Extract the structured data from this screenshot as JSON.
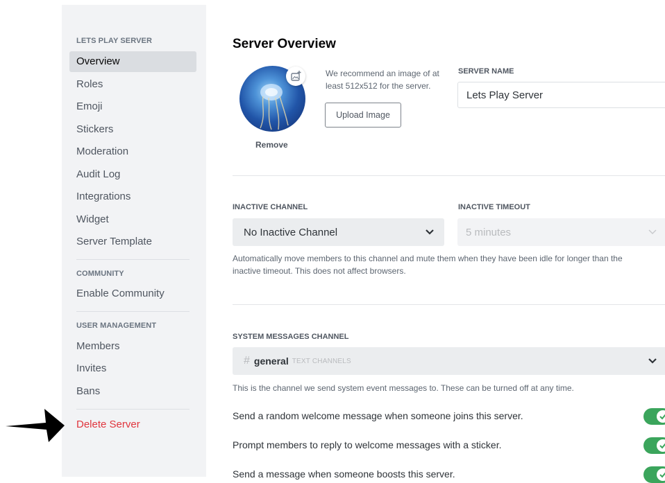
{
  "sidebar": {
    "server_header": "LETS PLAY SERVER",
    "items": [
      {
        "label": "Overview"
      },
      {
        "label": "Roles"
      },
      {
        "label": "Emoji"
      },
      {
        "label": "Stickers"
      },
      {
        "label": "Moderation"
      },
      {
        "label": "Audit Log"
      },
      {
        "label": "Integrations"
      },
      {
        "label": "Widget"
      },
      {
        "label": "Server Template"
      }
    ],
    "community_header": "COMMUNITY",
    "community_items": [
      {
        "label": "Enable Community"
      }
    ],
    "user_mgmt_header": "USER MANAGEMENT",
    "user_mgmt_items": [
      {
        "label": "Members"
      },
      {
        "label": "Invites"
      },
      {
        "label": "Bans"
      }
    ],
    "delete_label": "Delete Server"
  },
  "overview": {
    "title": "Server Overview",
    "remove_label": "Remove",
    "recommend_text": "We recommend an image of at least 512x512 for the server.",
    "upload_label": "Upload Image",
    "server_name_label": "SERVER NAME",
    "server_name_value": "Lets Play Server",
    "inactive_channel_label": "INACTIVE CHANNEL",
    "inactive_channel_value": "No Inactive Channel",
    "inactive_timeout_label": "INACTIVE TIMEOUT",
    "inactive_timeout_value": "5 minutes",
    "inactive_help": "Automatically move members to this channel and mute them when they have been idle for longer than the inactive timeout. This does not affect browsers.",
    "system_channel_label": "SYSTEM MESSAGES CHANNEL",
    "system_channel_hash": "#",
    "system_channel_name": "general",
    "system_channel_category": "TEXT CHANNELS",
    "system_help": "This is the channel we send system event messages to. These can be turned off at any time.",
    "toggles": [
      {
        "label": "Send a random welcome message when someone joins this server.",
        "on": true
      },
      {
        "label": "Prompt members to reply to welcome messages with a sticker.",
        "on": true
      },
      {
        "label": "Send a message when someone boosts this server.",
        "on": true
      }
    ]
  },
  "colors": {
    "accent_green": "#3ba55c",
    "danger_red": "#e0353d"
  },
  "icons": [
    "add-image-icon",
    "chevron-down-icon",
    "checkmark-icon",
    "arrow-pointer-icon"
  ]
}
